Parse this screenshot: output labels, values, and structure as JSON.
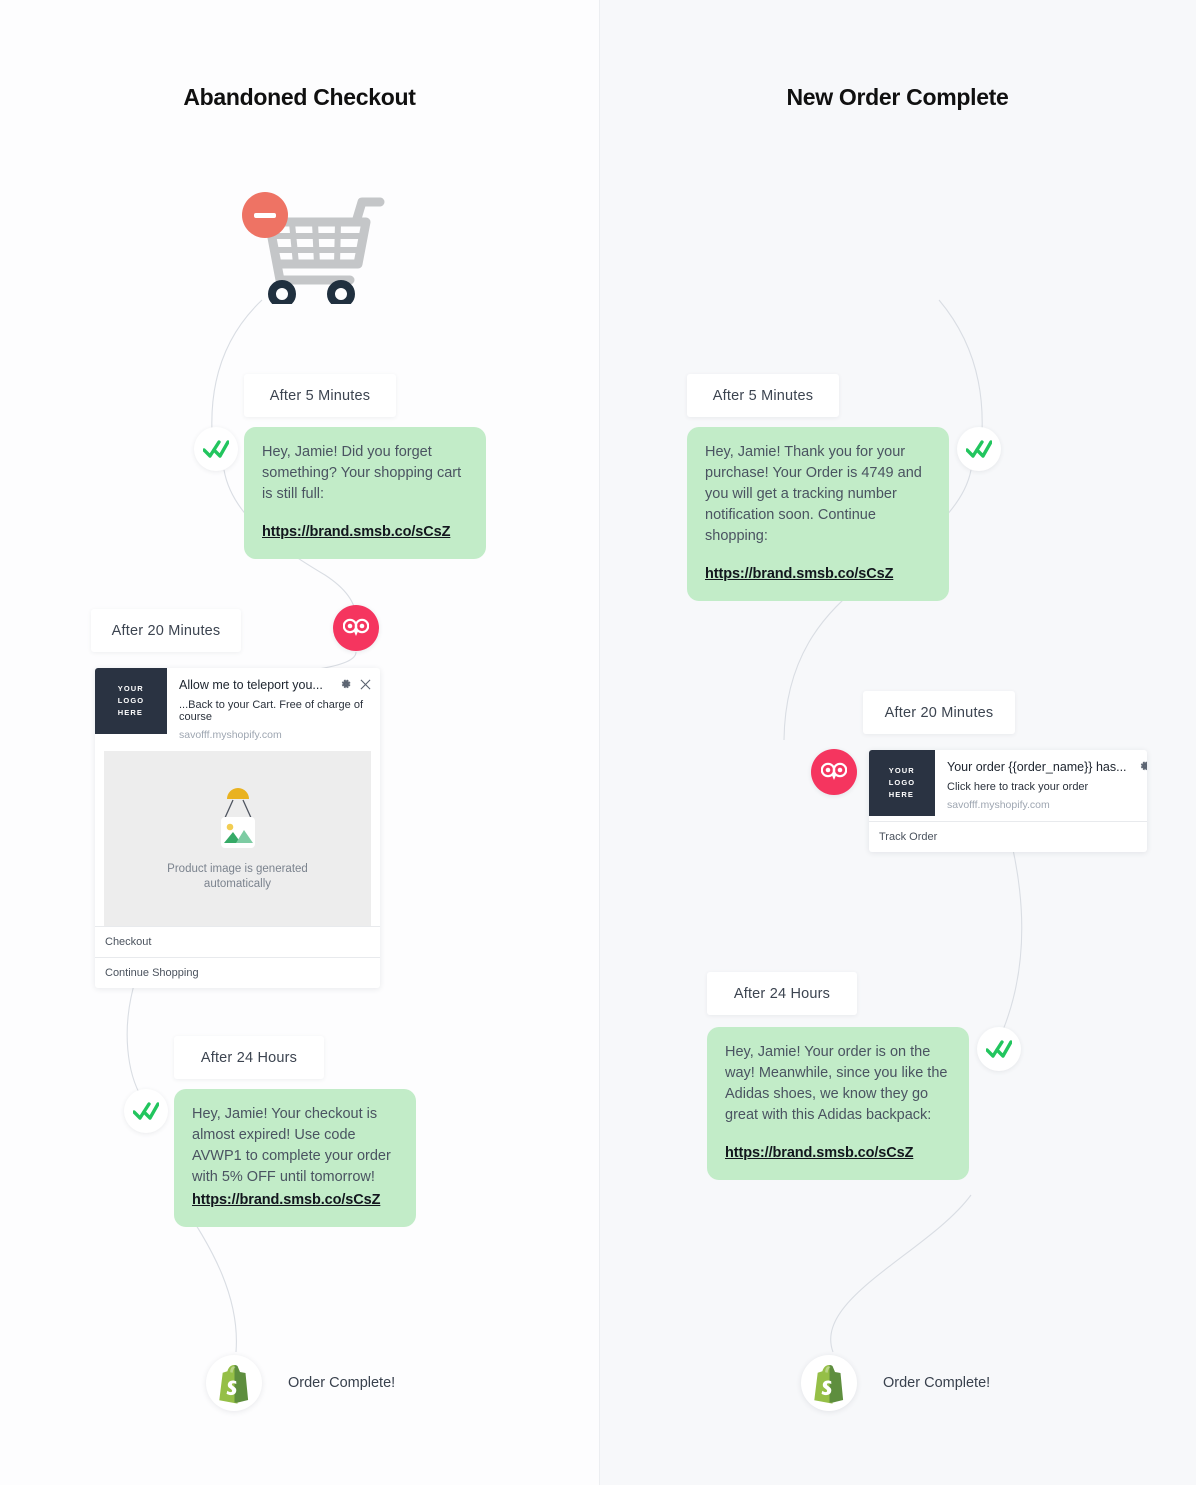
{
  "page": {
    "background_left": "#fdfdfe",
    "background_right": "#f7f8fa",
    "accent_sms_bubble": "#c2ecc8",
    "accent_owl": "#f5355f",
    "accent_shopify": "#95bf47",
    "accent_badge_remove": "#ee7364",
    "accent_badge_add": "#6cbf6c"
  },
  "flows": [
    {
      "title": "Abandoned Checkout",
      "cart": {
        "icon": "shopping-cart-icon",
        "badge": "minus-badge"
      },
      "steps": [
        {
          "time_label": "After 5 Minutes",
          "kind": "sms",
          "body": "Hey, Jamie! Did you forget something? Your shopping cart is still full:",
          "link": "https://brand.smsb.co/sCsZ"
        },
        {
          "time_label": "After 20 Minutes",
          "kind": "push",
          "logo_text": "YOUR\nLOGO\nHERE",
          "title": "Allow me to teleport you...",
          "subtitle": "...Back to your Cart. Free of charge of course",
          "url": "savofff.myshopify.com",
          "image_caption": "Product image is generated\nautomatically",
          "buttons": [
            "Checkout",
            "Continue Shopping"
          ]
        },
        {
          "time_label": "After 24 Hours",
          "kind": "sms",
          "body": "Hey, Jamie! Your checkout is almost expired! Use code AVWP1 to complete your order with 5% OFF until tomorrow!",
          "link": "https://brand.smsb.co/sCsZ"
        }
      ],
      "end": {
        "label": "Order Complete!",
        "icon": "shopify-bag-icon"
      }
    },
    {
      "title": "New Order Complete",
      "cart": {
        "icon": "shopping-cart-icon",
        "badge": "plus-badge"
      },
      "steps": [
        {
          "time_label": "After 5 Minutes",
          "kind": "sms",
          "body": "Hey, Jamie! Thank you for your purchase! Your Order is 4749 and you will get a tracking number notification soon. Continue shopping:",
          "link": "https://brand.smsb.co/sCsZ"
        },
        {
          "time_label": "After 20 Minutes",
          "kind": "push",
          "logo_text": "YOUR\nLOGO\nHERE",
          "title": "Your order {{order_name}} has...",
          "subtitle": "Click here to track your order",
          "url": "savofff.myshopify.com",
          "buttons": [
            "Track Order"
          ]
        },
        {
          "time_label": "After 24 Hours",
          "kind": "sms",
          "body": "Hey, Jamie! Your order is on the way! Meanwhile, since you like the Adidas shoes, we know they go great with this Adidas backpack:",
          "link": "https://brand.smsb.co/sCsZ"
        }
      ],
      "end": {
        "label": "Order Complete!",
        "icon": "shopify-bag-icon"
      }
    }
  ],
  "icons": {
    "double_check": "double-check-icon",
    "owl": "owl-icon",
    "gear": "gear-icon",
    "close": "close-icon",
    "placeholder_image": "image-placeholder-icon"
  }
}
